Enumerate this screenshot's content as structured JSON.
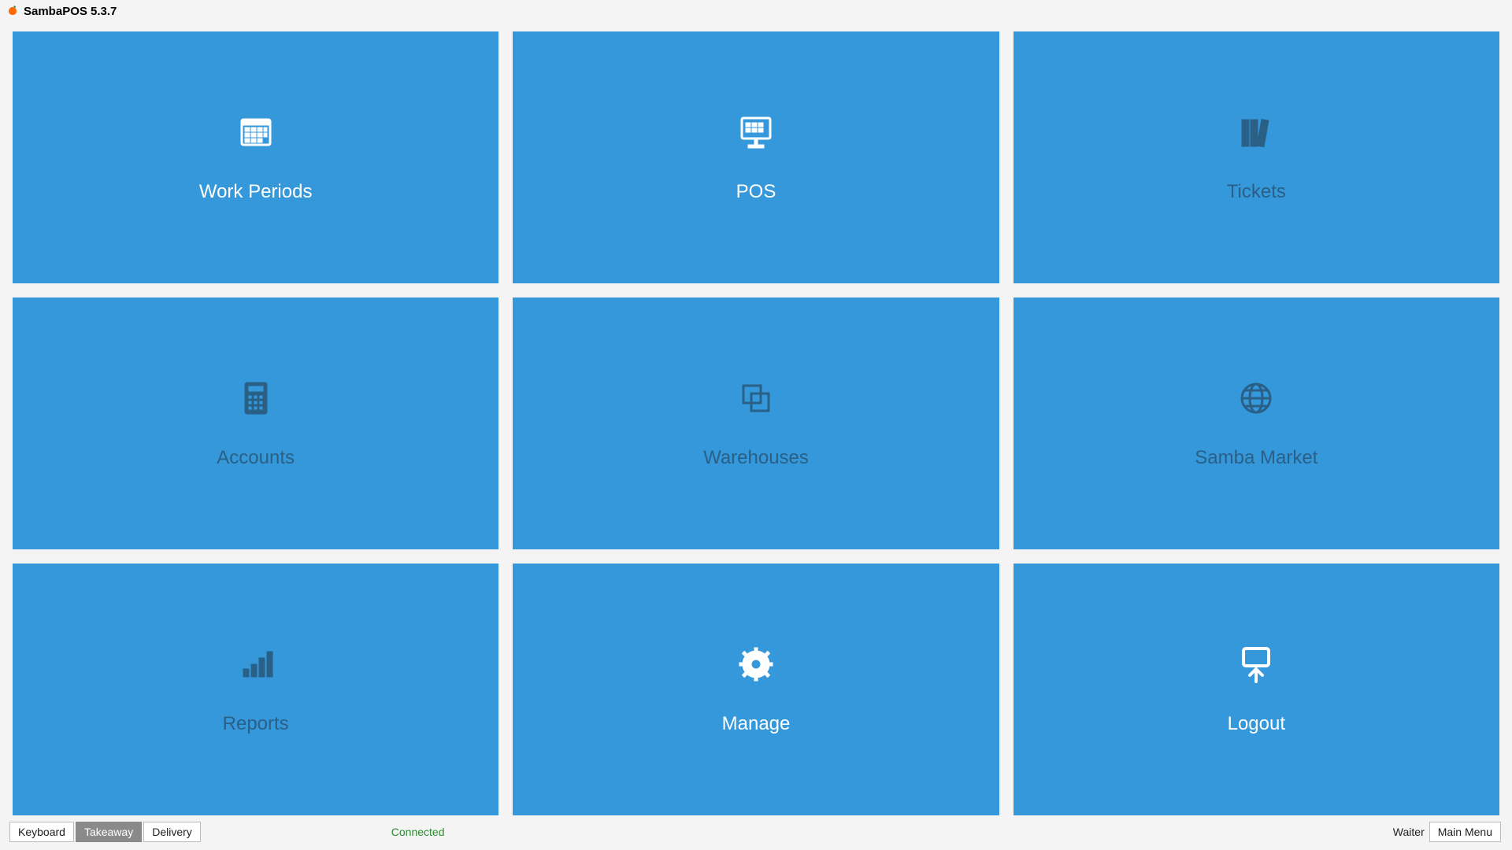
{
  "title": "SambaPOS 5.3.7",
  "tiles": [
    {
      "id": "work-periods",
      "label": "Work Periods",
      "icon": "calendar-icon",
      "enabled": true
    },
    {
      "id": "pos",
      "label": "POS",
      "icon": "monitor-icon",
      "enabled": true
    },
    {
      "id": "tickets",
      "label": "Tickets",
      "icon": "books-icon",
      "enabled": false
    },
    {
      "id": "accounts",
      "label": "Accounts",
      "icon": "calculator-icon",
      "enabled": false
    },
    {
      "id": "warehouses",
      "label": "Warehouses",
      "icon": "copy-icon",
      "enabled": false
    },
    {
      "id": "samba-market",
      "label": "Samba Market",
      "icon": "globe-icon",
      "enabled": false
    },
    {
      "id": "reports",
      "label": "Reports",
      "icon": "bars-icon",
      "enabled": false
    },
    {
      "id": "manage",
      "label": "Manage",
      "icon": "gear-icon",
      "enabled": true
    },
    {
      "id": "logout",
      "label": "Logout",
      "icon": "logout-icon",
      "enabled": true
    }
  ],
  "footer": {
    "buttons": [
      {
        "label": "Keyboard",
        "active": false
      },
      {
        "label": "Takeaway",
        "active": true
      },
      {
        "label": "Delivery",
        "active": false
      }
    ],
    "status": "Connected",
    "user": "Waiter",
    "menu_label": "Main Menu"
  }
}
